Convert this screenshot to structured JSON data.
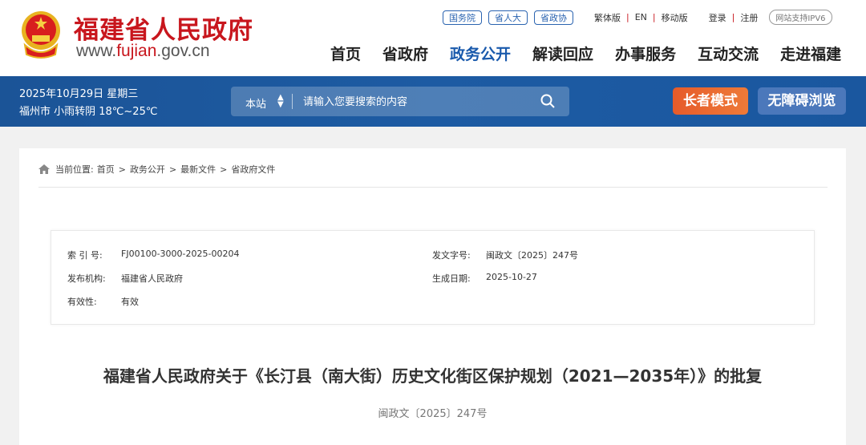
{
  "header": {
    "site_name": "福建省人民政府",
    "url_prefix": "www.",
    "url_mid": "fujian",
    "url_suffix": ".gov.cn",
    "top_pills": [
      "国务院",
      "省人大",
      "省政协"
    ],
    "lang_links": [
      "繁体版",
      "EN",
      "移动版"
    ],
    "account_links": [
      "登录",
      "注册"
    ],
    "ipv6": "网站支持IPV6",
    "nav": [
      "首页",
      "省政府",
      "政务公开",
      "解读回应",
      "办事服务",
      "互动交流",
      "走进福建"
    ],
    "active_nav": "政务公开"
  },
  "band": {
    "date": "2025年10月29日 星期三",
    "weather": "福州市 小雨转阴 18℃~25℃",
    "search_scope": "本站",
    "search_placeholder": "请输入您要搜索的内容",
    "elder_mode": "长者模式",
    "accessibility": "无障碍浏览"
  },
  "breadcrumb": {
    "label": "当前位置:",
    "items": [
      "首页",
      "政务公开",
      "最新文件",
      "省政府文件"
    ]
  },
  "info": {
    "index_label": "索 引 号:",
    "index_value": "FJ00100-3000-2025-00204",
    "docno_label": "发文字号:",
    "docno_value": "闽政文〔2025〕247号",
    "org_label": "发布机构:",
    "org_value": "福建省人民政府",
    "date_label": "生成日期:",
    "date_value": "2025-10-27",
    "validity_label": "有效性:",
    "validity_value": "有效"
  },
  "article": {
    "title": "福建省人民政府关于《长汀县（南大街）历史文化街区保护规划（2021—2035年）》的批复",
    "doc_number": "闽政文〔2025〕247号"
  },
  "colors": {
    "brand_red": "#c8161d",
    "brand_blue": "#1d5aa0",
    "elder_orange": "#e8642f"
  }
}
